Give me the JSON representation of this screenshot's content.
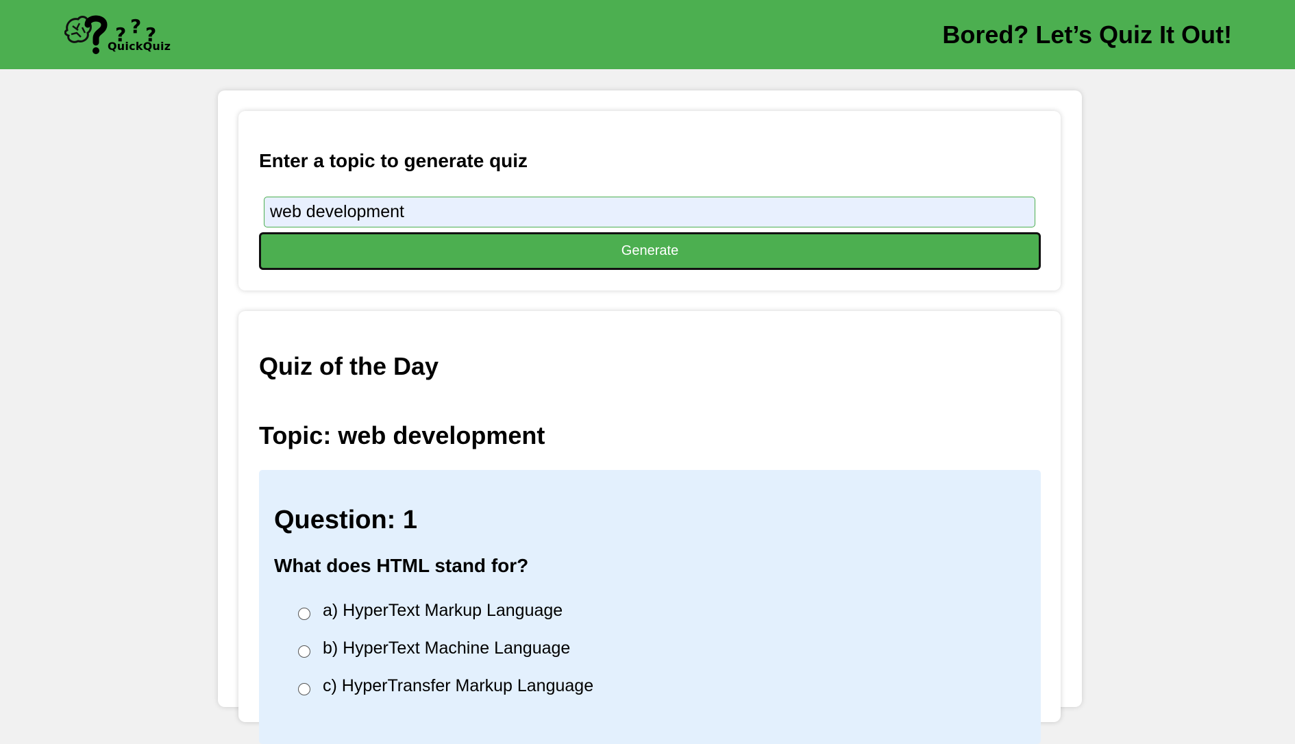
{
  "header": {
    "logo_text": "QuickQuiz",
    "tagline": "Bored? Let’s Quiz It Out!",
    "color": "#4caf50"
  },
  "topic_form": {
    "label": "Enter a topic to generate quiz",
    "input_value": "web development",
    "generate_label": "Generate"
  },
  "quiz": {
    "title": "Quiz of the Day",
    "topic": "Topic: web development",
    "questions": [
      {
        "number": "Question: 1",
        "text": "What does HTML stand for?",
        "options": [
          "a) HyperText Markup Language",
          "b) HyperText Machine Language",
          "c) HyperTransfer Markup Language"
        ]
      }
    ]
  }
}
